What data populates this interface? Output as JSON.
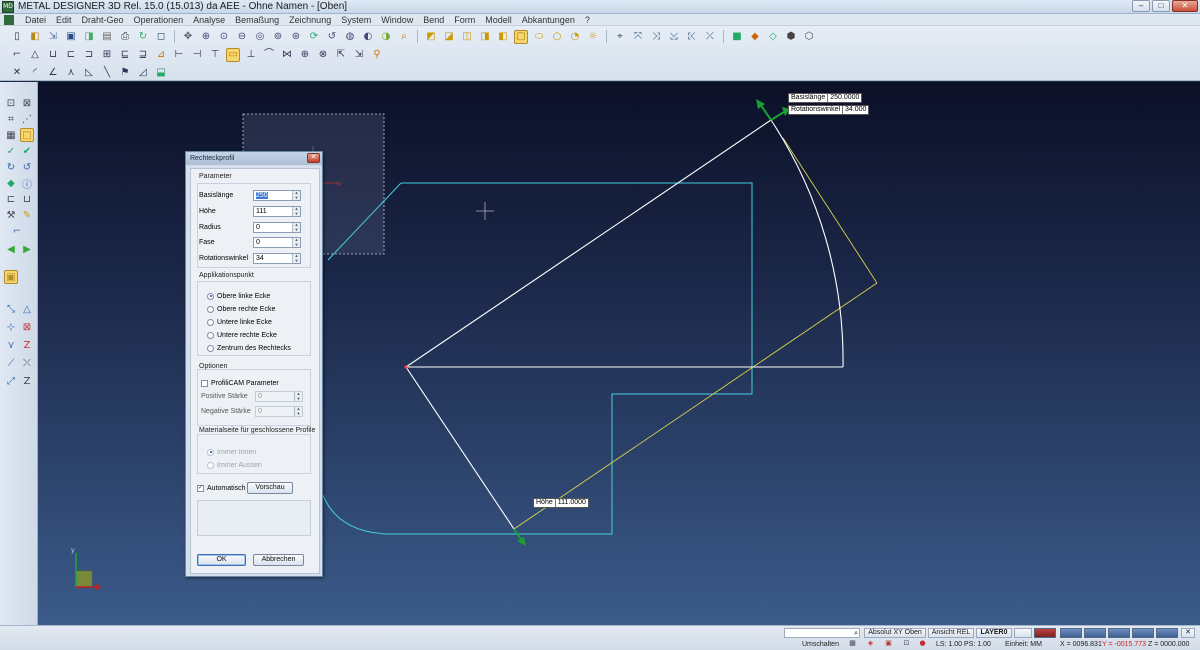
{
  "window": {
    "title": "METAL DESIGNER 3D Rel. 15.0 (15.013) da AEE - Ohne Namen - [Oben]",
    "app_icon_text": "MD"
  },
  "menu": [
    "Datei",
    "Edit",
    "Draht-Geo",
    "Operationen",
    "Analyse",
    "Bemaßung",
    "Zeichnung",
    "System",
    "Window",
    "Bend",
    "Form",
    "Modell",
    "Abkantungen",
    "?"
  ],
  "viewport": {
    "tag_basis": {
      "label": "Basislänge",
      "value": "250.0000"
    },
    "tag_rotation": {
      "label": "Rotationswinkel",
      "value": "34.000"
    },
    "tag_hoehe": {
      "label": "Höhe",
      "value": "111.0000"
    },
    "colors": {
      "rect": "#ffffff",
      "guide": "#45d0e0",
      "diagonal": "#d8d24a",
      "arrow": "#19a033"
    }
  },
  "dialog": {
    "title": "Rechteckprofil",
    "parameter": {
      "title": "Parameter",
      "fields": [
        {
          "label": "Basislänge",
          "value": "250"
        },
        {
          "label": "Höhe",
          "value": "111"
        },
        {
          "label": "Radius",
          "value": "0"
        },
        {
          "label": "Fase",
          "value": "0"
        },
        {
          "label": "Rotationswinkel",
          "value": "34"
        }
      ]
    },
    "applikation": {
      "title": "Applikationspunkt",
      "options": [
        "Obere linke Ecke",
        "Obere rechte Ecke",
        "Untere linke Ecke",
        "Untere rechte Ecke",
        "Zentrum des Rechtecks"
      ],
      "selected": "Obere linke Ecke"
    },
    "optionen": {
      "title": "Optionen",
      "profilcam_label": "ProfiliCAM Parameter",
      "positive_label": "Positive Stärke",
      "positive_value": "0",
      "negative_label": "Negative Stärke",
      "negative_value": "0"
    },
    "material": {
      "title": "Materialseite für geschlossene Profile",
      "options": [
        "Immer Innen",
        "Immer Aussen"
      ]
    },
    "automatisch_label": "Automatisch",
    "vorschau_label": "Vorschau",
    "ok_label": "OK",
    "cancel_label": "Abbrechen"
  },
  "statusbar": {
    "search_value": "",
    "buttons": [
      "Absolut XY Oben",
      "Ansicht REL",
      "LAYER0"
    ],
    "umschalten": "Umschalten",
    "ls_ps": "LS: 1.00 PS: 1.00",
    "einheit": "Einheit: MM",
    "x": "X = 0096.831",
    "y": "Y = -0015.773",
    "z": "Z = 0000.000"
  }
}
